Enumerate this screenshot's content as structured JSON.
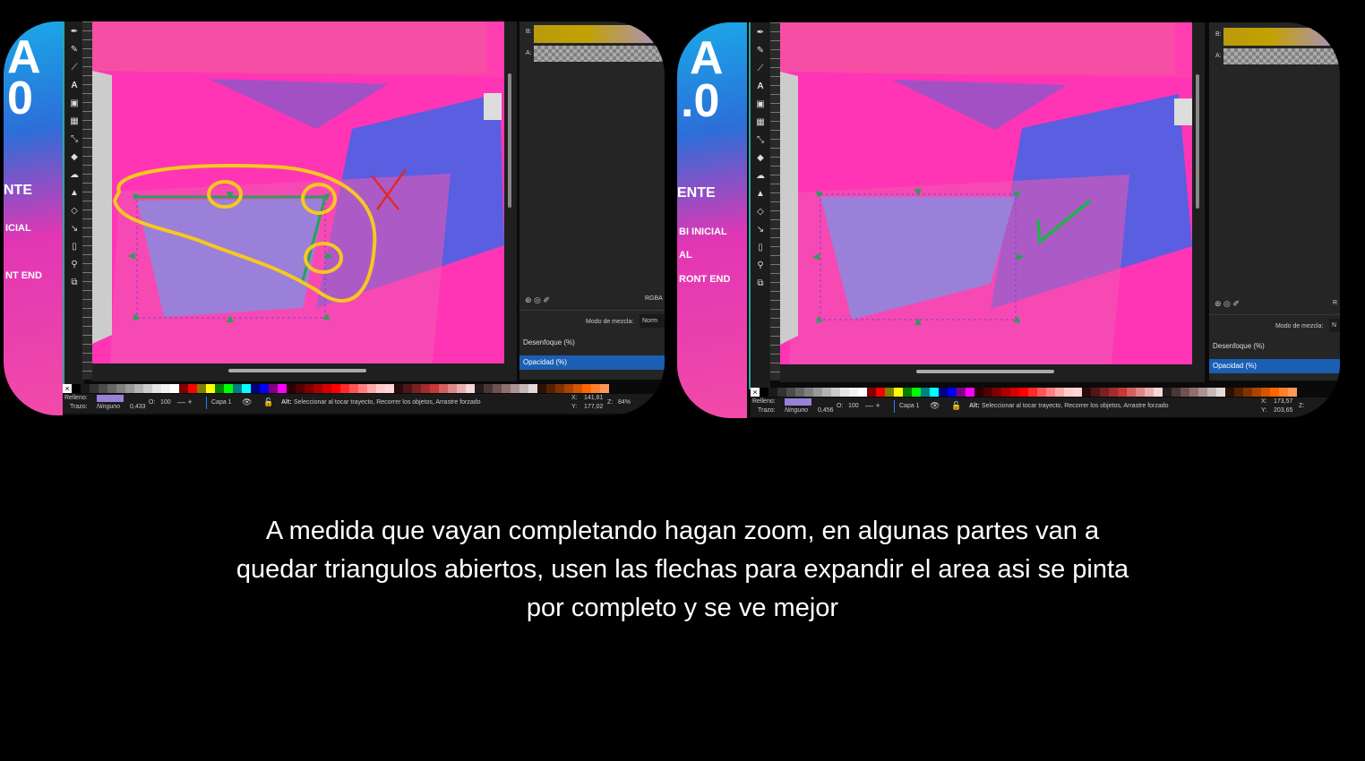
{
  "left": {
    "poster": {
      "big1": "A",
      "big2": "0",
      "line1": "NTE",
      "line2": "ICIAL",
      "line3": "NT END"
    },
    "panel": {
      "b_label": "B:",
      "a_label": "A:",
      "rgba": "RGBA",
      "blend_label": "Modo de mezcla:",
      "blend_value": "Norm",
      "blur_label": "Desenfoque (%)",
      "opacity_label": "Opacidad (%)"
    },
    "status": {
      "fill_label": "Relleno:",
      "stroke_label": "Trazo:",
      "stroke_value": "Ninguno",
      "stroke_width": "0,433",
      "opacity_label": "O:",
      "opacity_value": "100",
      "layer": "Capa 1",
      "hint_bold": "Alt:",
      "hint": "Seleccionar al tocar trayecto, Recorrer los objetos, Arrastre forzado",
      "x_label": "X:",
      "x_value": "141,61",
      "y_label": "Y:",
      "y_value": "177,02",
      "zoom_label": "Z:",
      "zoom_value": "84%"
    }
  },
  "right": {
    "poster": {
      "big1": "A",
      "big2": ".0",
      "line1": "ENTE",
      "line2": "BI INICIAL",
      "line3": "AL",
      "line4": "RONT END"
    },
    "panel": {
      "b_label": "B:",
      "a_label": "A:",
      "rgba": "R",
      "blend_label": "Modo de mezcla:",
      "blend_value": "N",
      "blur_label": "Desenfoque (%)",
      "opacity_label": "Opacidad (%)"
    },
    "status": {
      "fill_label": "Relleno:",
      "stroke_label": "Trazo:",
      "stroke_value": "Ninguno",
      "stroke_width": "0,456",
      "opacity_label": "O:",
      "opacity_value": "100",
      "layer": "Capa 1",
      "hint_bold": "Alt:",
      "hint": "Seleccionar al tocar trayecto, Recorrer los objetos, Arrastre forzado",
      "x_label": "X:",
      "x_value": "173,57",
      "y_label": "Y:",
      "y_value": "203,65",
      "zoom_label": "Z:",
      "zoom_value": ""
    }
  },
  "caption": {
    "line1": "A medida que vayan completando hagan zoom, en algunas partes van a",
    "line2": "quedar triangulos abiertos, usen las flechas para expandir el area asi se pinta",
    "line3": "por completo y se ve mejor"
  },
  "colors": {
    "canvas_pink": "#ff3fb0",
    "shape_blue": "#5a5ee0",
    "shape_purple": "#8f56c8",
    "selection_fill": "#9a80d8",
    "annotation_yellow": "#f7c81e",
    "annotation_red": "#e02a2a",
    "annotation_green": "#1fb34a",
    "panel_bg": "#252525",
    "selected_row": "#1a5fb4"
  },
  "icons": [
    "pen-icon",
    "pencil-icon",
    "calligraphy-icon",
    "text-icon",
    "gradient-icon",
    "mesh-icon",
    "dropper-icon",
    "paint-bucket-icon",
    "tweak-icon",
    "spray-icon",
    "eraser-icon",
    "connector-icon",
    "page-icon",
    "zoom-icon",
    "clone-icon"
  ]
}
